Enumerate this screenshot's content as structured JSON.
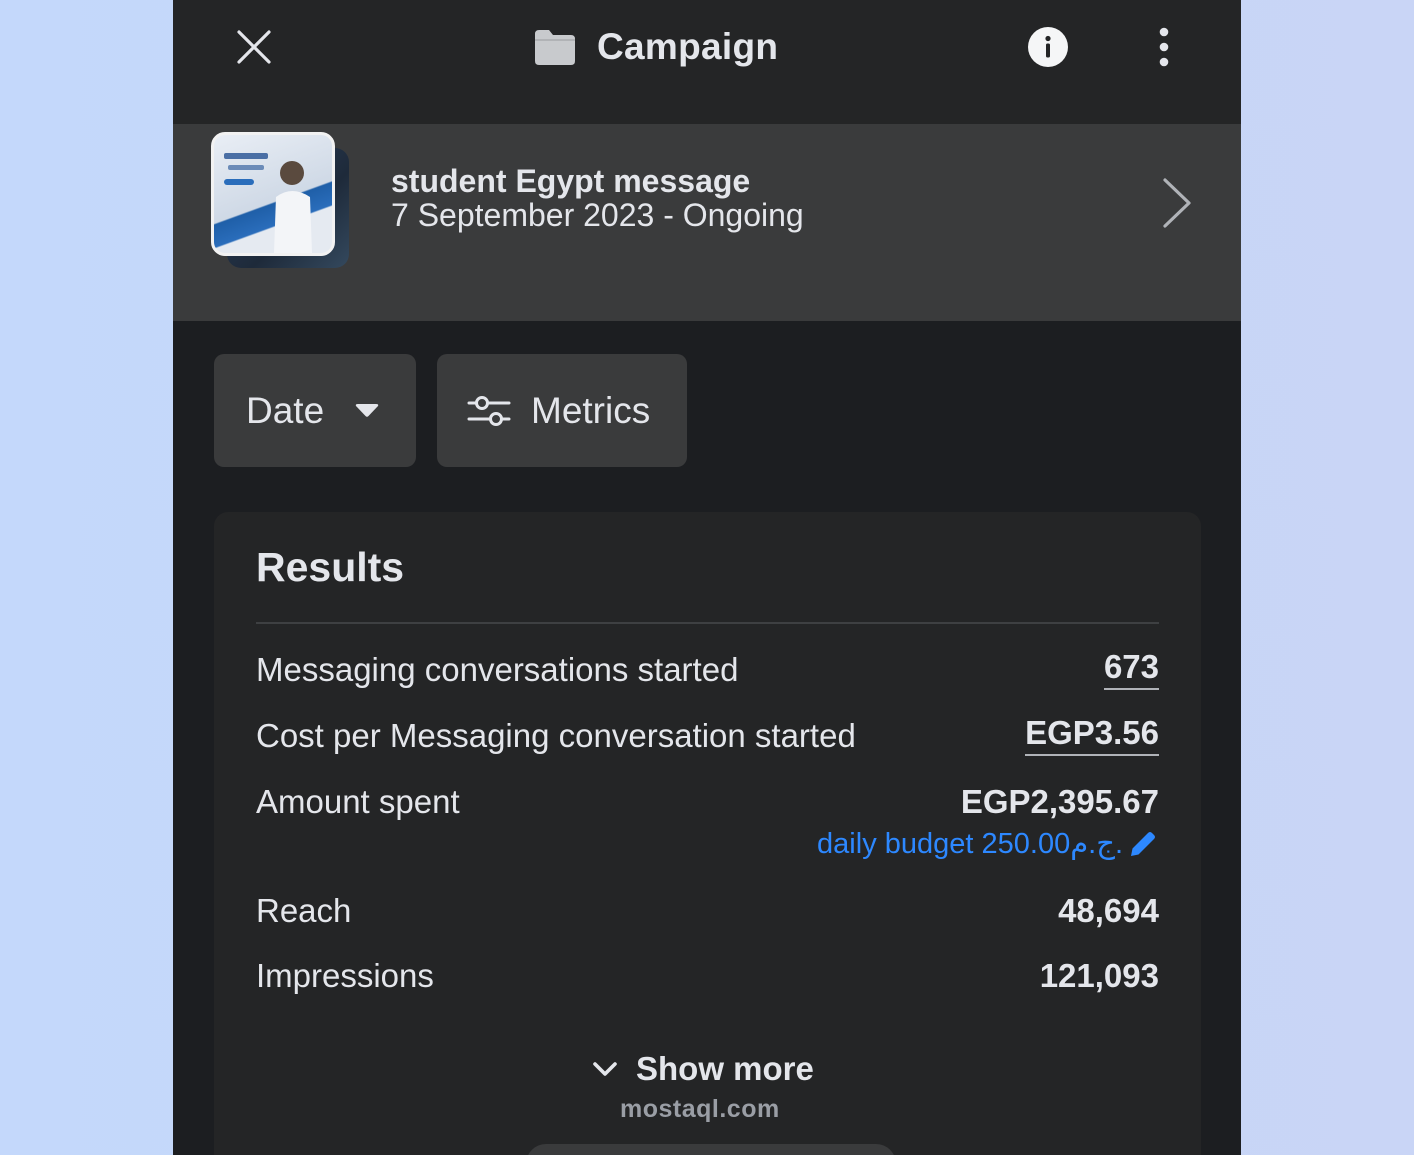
{
  "header": {
    "title": "Campaign",
    "close_icon": "close-icon",
    "folder_icon": "folder-icon",
    "info_icon": "info-icon",
    "more_icon": "more-vertical-icon"
  },
  "ad": {
    "name": "student Egypt message",
    "date_range": "7 September 2023 -  Ongoing"
  },
  "filters": {
    "date_label": "Date",
    "metrics_label": "Metrics"
  },
  "results": {
    "title": "Results",
    "rows": [
      {
        "label": "Messaging conversations started",
        "value": "673"
      },
      {
        "label": "Cost per Messaging conversation started",
        "value": "EGP3.56"
      },
      {
        "label": "Amount spent",
        "value": "EGP2,395.67"
      },
      {
        "label": "Reach",
        "value": "48,694"
      },
      {
        "label": "Impressions",
        "value": "121,093"
      }
    ],
    "daily_budget": "daily budget 250.00ج.م.",
    "show_more": "Show more"
  },
  "watermark": "mostaql.com",
  "colors": {
    "background": "#1c1e21",
    "surface": "#242526",
    "chip": "#3a3b3c",
    "text": "#e4e6eb",
    "link": "#2d88ff"
  }
}
